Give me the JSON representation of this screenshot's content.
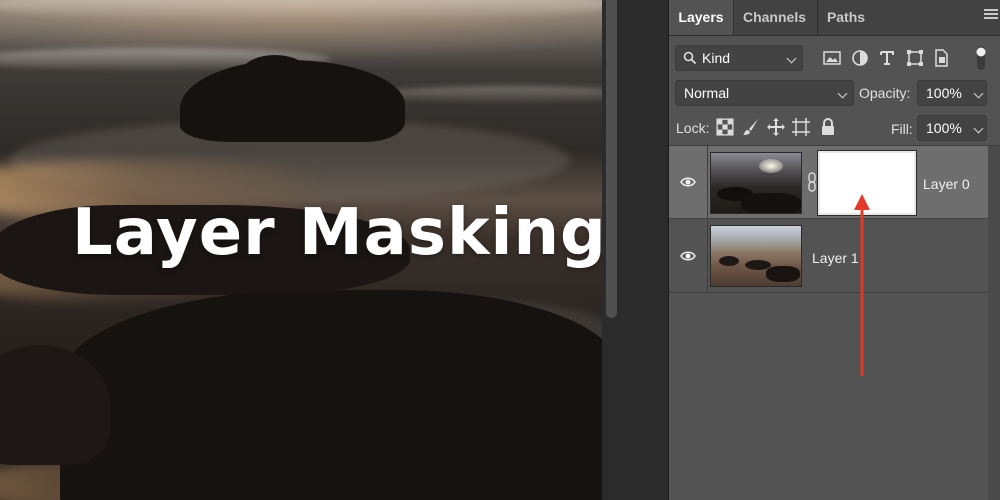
{
  "canvas": {
    "title": "Layer Masking"
  },
  "panel": {
    "tabs": [
      {
        "label": "Layers",
        "active": true
      },
      {
        "label": "Channels",
        "active": false
      },
      {
        "label": "Paths",
        "active": false
      }
    ],
    "filter": {
      "value": "Kind"
    },
    "blend_mode": {
      "value": "Normal"
    },
    "opacity": {
      "label": "Opacity:",
      "value": "100%"
    },
    "lock": {
      "label": "Lock:"
    },
    "fill": {
      "label": "Fill:",
      "value": "100%"
    },
    "layers": [
      {
        "name": "Layer 0",
        "visible": true,
        "selected": true,
        "has_mask": true,
        "linked": true
      },
      {
        "name": "Layer 1",
        "visible": true,
        "selected": false,
        "has_mask": false
      }
    ]
  },
  "annotation": {
    "arrow_color": "#e23a2a",
    "points_to": "layer-mask-thumbnail"
  },
  "colors": {
    "panel_bg": "#535353",
    "tabbar_bg": "#424242",
    "selected_row": "#6e6e6e",
    "dropdown_bg": "#434343"
  },
  "icons": [
    "search-icon",
    "image-filter-icon",
    "adjustment-filter-icon",
    "type-filter-icon",
    "shape-filter-icon",
    "smart-object-filter-icon",
    "filter-toggle-icon",
    "lock-transparent-pixels-icon",
    "lock-image-pixels-icon",
    "lock-position-icon",
    "lock-artboard-icon",
    "lock-all-icon",
    "eye-icon",
    "chain-link-icon",
    "panel-menu-icon"
  ]
}
